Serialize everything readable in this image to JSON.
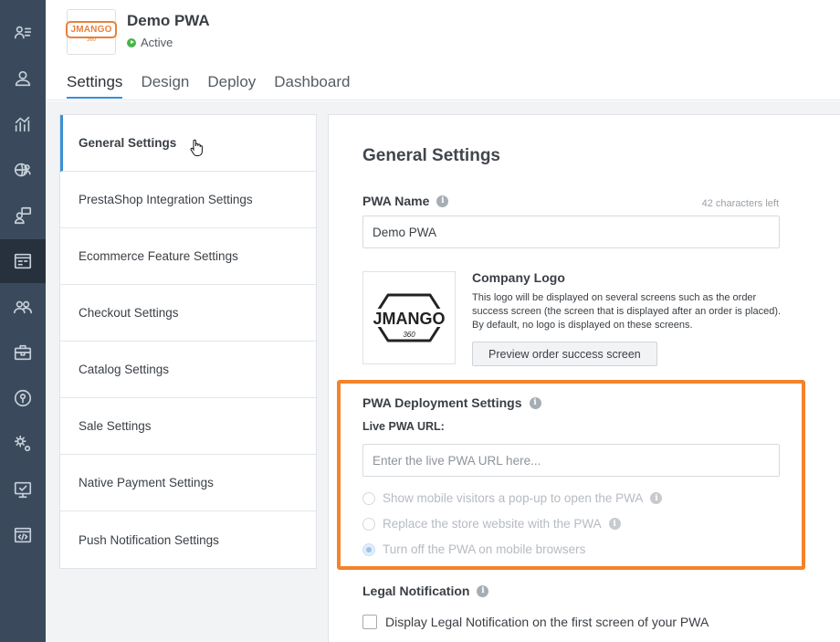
{
  "rail": {
    "icons": [
      "contacts-list-icon",
      "user-icon",
      "analytics-icon",
      "global-users-icon",
      "support-chat-icon",
      "app-settings-icon",
      "team-icon",
      "toolbox-icon",
      "lock-icon",
      "gears-icon",
      "monitor-check-icon",
      "code-window-icon"
    ],
    "active_index": 5
  },
  "app": {
    "name": "Demo PWA",
    "status": "Active",
    "logo_text": "JMANGO",
    "logo_sub": "360",
    "brand_color": "#e8813a"
  },
  "tabs": [
    {
      "label": "Settings",
      "active": true
    },
    {
      "label": "Design",
      "active": false
    },
    {
      "label": "Deploy",
      "active": false
    },
    {
      "label": "Dashboard",
      "active": false
    }
  ],
  "menu": {
    "items": [
      "General Settings",
      "PrestaShop Integration Settings",
      "Ecommerce Feature Settings",
      "Checkout Settings",
      "Catalog Settings",
      "Sale Settings",
      "Native Payment Settings",
      "Push Notification Settings"
    ],
    "active_index": 0
  },
  "main": {
    "title": "General Settings",
    "pwa_name": {
      "label": "PWA Name",
      "chars_left": "42 characters left",
      "value": "Demo PWA"
    },
    "company_logo": {
      "title": "Company Logo",
      "logo_text": "JMANGO",
      "logo_sub": "360",
      "description": "This logo will be displayed on several screens such as the order success screen (the screen that is displayed after an order is placed). By default, no logo is displayed on these screens.",
      "button": "Preview order success screen"
    },
    "deployment": {
      "title": "PWA Deployment Settings",
      "url_label": "Live PWA URL:",
      "url_placeholder": "Enter the live PWA URL here...",
      "options": [
        {
          "label": "Show mobile visitors a pop-up to open the PWA",
          "info": true,
          "checked": false
        },
        {
          "label": "Replace the store website with the PWA",
          "info": true,
          "checked": false
        },
        {
          "label": "Turn off the PWA on mobile browsers",
          "info": false,
          "checked": true
        }
      ],
      "highlight_color": "#f5822a"
    },
    "legal": {
      "title": "Legal Notification",
      "checkbox_label": "Display Legal Notification on the first screen of your PWA",
      "checked": false
    }
  }
}
